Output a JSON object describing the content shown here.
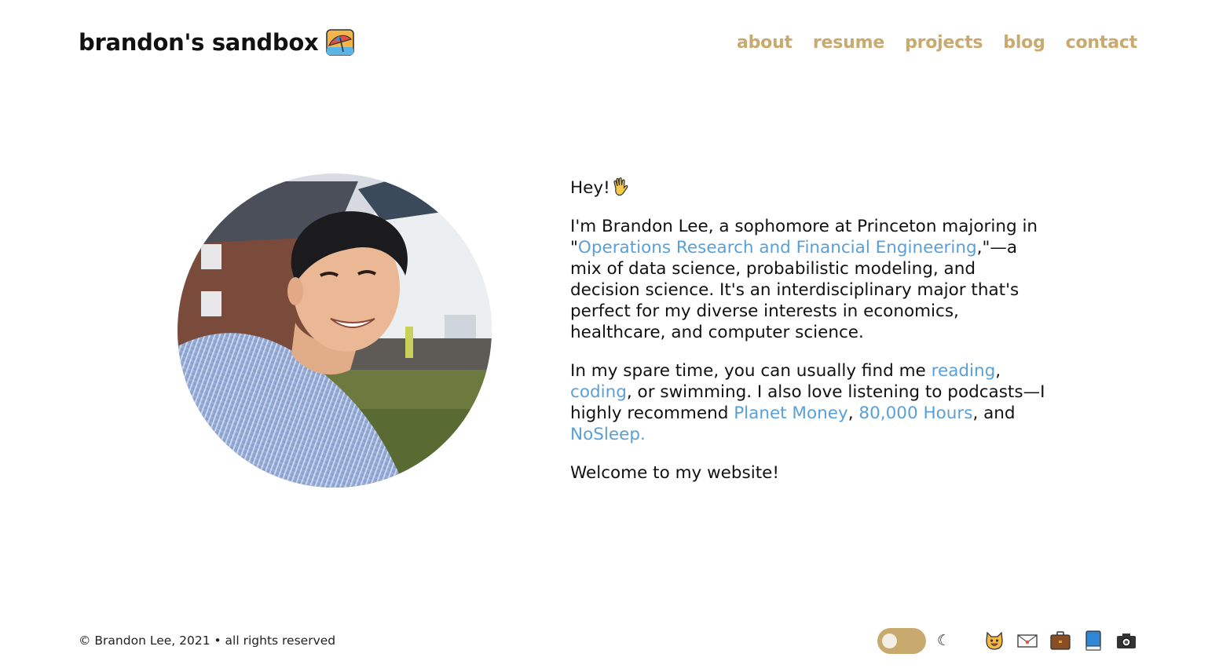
{
  "header": {
    "brand_title": "brandon's sandbox",
    "brand_icon": "beach-umbrella-icon",
    "nav": [
      {
        "label": "about"
      },
      {
        "label": "resume"
      },
      {
        "label": "projects"
      },
      {
        "label": "blog"
      },
      {
        "label": "contact"
      }
    ]
  },
  "hero": {
    "portrait_icon": "profile-photo",
    "greeting": "Hey!",
    "wave_icon": "waving-hand-icon",
    "p1": {
      "t1": "I'm Brandon Lee, a sophomore at Princeton majoring in \"",
      "link": "Operations Research and Financial Engineering",
      "t2": ",\"—a mix of data science, probabilistic modeling, and decision science. It's an interdisciplinary major that's perfect for my diverse interests in economics, healthcare, and computer science."
    },
    "p2": {
      "t1": "In my spare time, you can usually find me ",
      "link_reading": "reading",
      "t2": ", ",
      "link_coding": "coding",
      "t3": ", or swimming. I also love listening to podcasts—I highly recommend ",
      "link_planet": "Planet Money",
      "t4": ", ",
      "link_80k": "80,000 Hours",
      "t5": ", and ",
      "link_nosleep": "NoSleep."
    },
    "p3": "Welcome to my website!"
  },
  "footer": {
    "copyright": "© Brandon Lee, 2021 • all rights reserved",
    "moon_glyph": "☾",
    "social_icons": [
      "github-cat-icon",
      "email-envelope-icon",
      "briefcase-icon",
      "book-icon",
      "camera-icon"
    ]
  },
  "colors": {
    "accent": "#c8a96e",
    "link": "#5aa0d8",
    "text": "#111111"
  }
}
